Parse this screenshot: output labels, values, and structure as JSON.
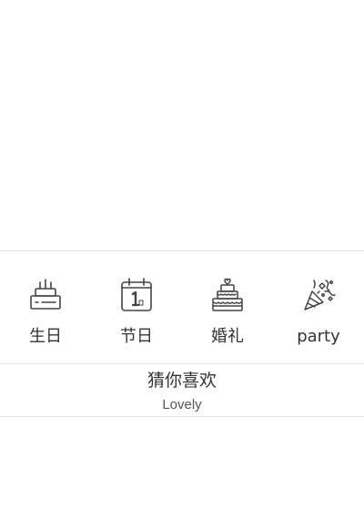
{
  "categories": [
    {
      "label": "生日",
      "icon": "birthday-cake-icon"
    },
    {
      "label": "节日",
      "icon": "calendar-icon"
    },
    {
      "label": "婚礼",
      "icon": "wedding-cake-icon"
    },
    {
      "label": "party",
      "icon": "party-popper-icon"
    }
  ],
  "recommend": {
    "title": "猜你喜欢",
    "subtitle": "Lovely"
  },
  "colors": {
    "divider": "#e4e4e4",
    "text": "#333333",
    "icon_stroke": "#444444"
  }
}
